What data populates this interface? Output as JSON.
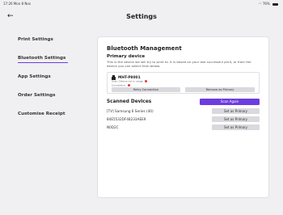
{
  "status_bar": {
    "time": "17:26 Mon 8 Nov",
    "battery": "76%"
  },
  "header": {
    "title": "Settings"
  },
  "sidebar": {
    "items": [
      {
        "label": "Print Settings"
      },
      {
        "label": "Bluetooth Settings",
        "active": true
      },
      {
        "label": "App Settings"
      },
      {
        "label": "Order Settings"
      },
      {
        "label": "Customise Receipt"
      }
    ]
  },
  "panel": {
    "title": "Bluetooth Management",
    "primary_heading": "Primary device",
    "primary_desc": "This is the device we will try to print to. It is based on your last successful print, or from the device you can select from below.",
    "device": {
      "name": "MHT-P8001",
      "scan_status": "Scan: Device not in range",
      "connection_status": "Connection:",
      "retry_label": "Retry Connection",
      "remove_label": "Remove as Primary"
    },
    "scanned_heading": "Scanned Devices",
    "scan_again_label": "Scan Again",
    "scanned": [
      {
        "name": "[TV] Samsung 6 Series (40)",
        "action": "Set as Primary"
      },
      {
        "name": "84E5532DF48233AEE9",
        "action": "Set as Primary"
      },
      {
        "name": "N0D2C",
        "action": "Set as Primary"
      }
    ]
  },
  "colors": {
    "accent": "#6c3ce0",
    "status_error": "#e53935"
  }
}
